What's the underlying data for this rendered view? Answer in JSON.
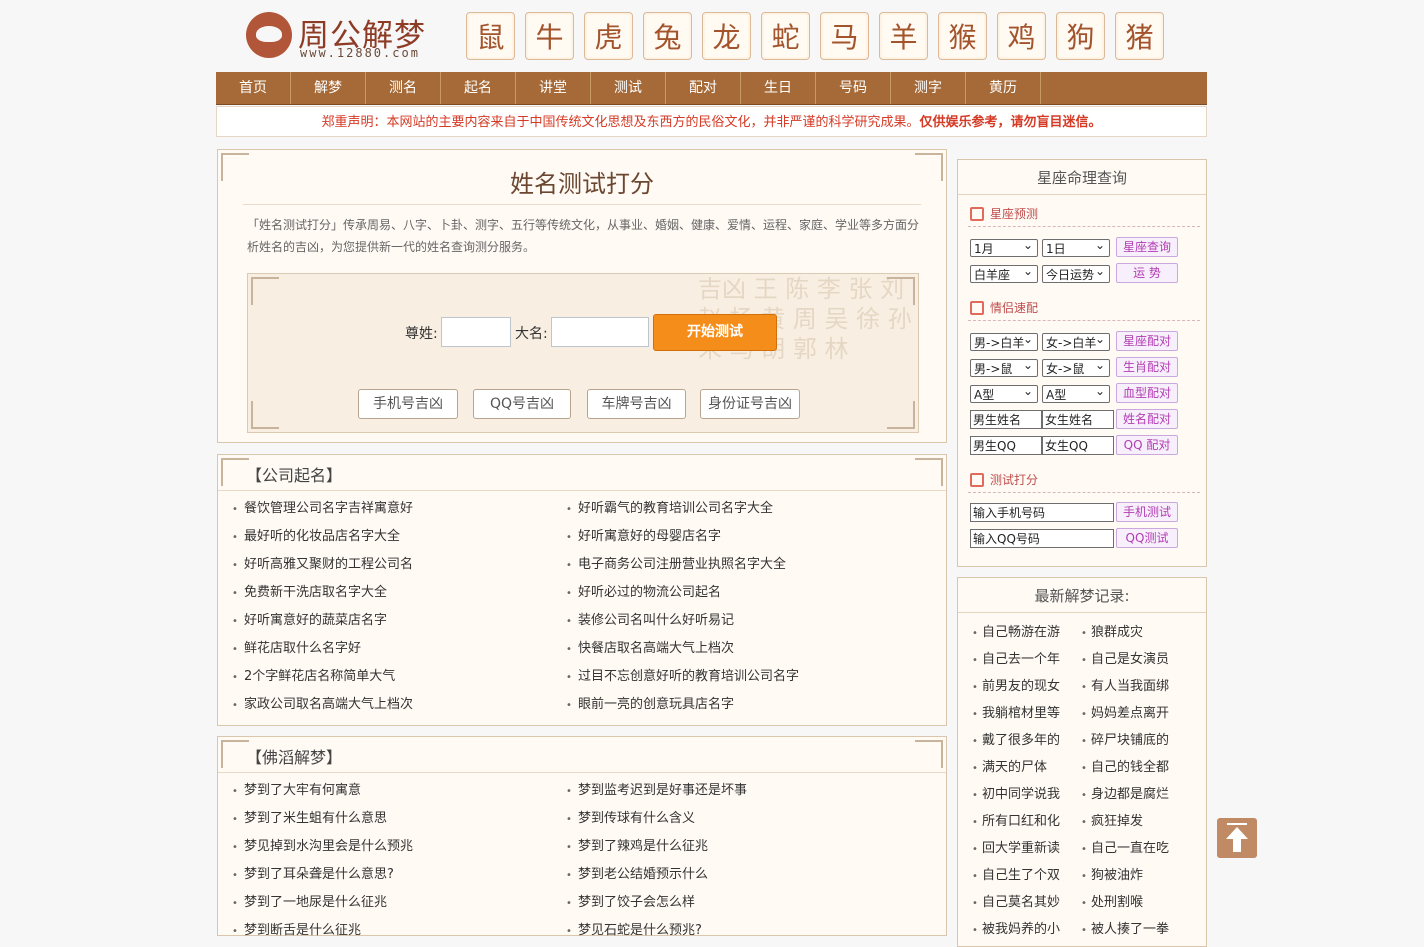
{
  "logo": {
    "name": "周公解梦",
    "url": "www.12880.com"
  },
  "zodiac": [
    "鼠",
    "牛",
    "虎",
    "兔",
    "龙",
    "蛇",
    "马",
    "羊",
    "猴",
    "鸡",
    "狗",
    "猪"
  ],
  "nav": [
    "首页",
    "解梦",
    "测名",
    "起名",
    "讲堂",
    "测试",
    "配对",
    "生日",
    "号码",
    "测字",
    "黄历"
  ],
  "notice": {
    "prefix": "郑重声明：本网站的主要内容来自于中国传统文化思想及东西方的民俗文化，并非严谨的科学研究成果。",
    "bold": "仅供娱乐参考，请勿盲目迷信。"
  },
  "name_test": {
    "title": "姓名测试打分",
    "desc": "「姓名测试打分」传承周易、八字、卜卦、测字、五行等传统文化，从事业、婚姻、健康、爱情、运程、家庭、学业等多方面分析姓名的吉凶，为您提供新一代的姓名查询测分服务。",
    "surname_label": "尊姓:",
    "name_label": "大名:",
    "start": "开始测试",
    "buttons": [
      "手机号吉凶",
      "QQ号吉凶",
      "车牌号吉凶",
      "身份证号吉凶"
    ],
    "bg_text": "吉凶 王 陈 李 张 刘 赵 杨 黄 周 吴 徐 孙 朱 马 胡 郭 林"
  },
  "company": {
    "title": "【公司起名】",
    "left": [
      "餐饮管理公司名字吉祥寓意好",
      "最好听的化妆品店名字大全",
      "好听高雅又聚财的工程公司名",
      "免费新干洗店取名字大全",
      "好听寓意好的蔬菜店名字",
      "鲜花店取什么名字好",
      "2个字鲜花店名称简单大气",
      "家政公司取名高端大气上档次"
    ],
    "right": [
      "好听霸气的教育培训公司名字大全",
      "好听寓意好的母婴店名字",
      "电子商务公司注册营业执照名字大全",
      "好听必过的物流公司起名",
      "装修公司名叫什么好听易记",
      "快餐店取名高端大气上档次",
      "过目不忘创意好听的教育培训公司名字",
      "眼前一亮的创意玩具店名字"
    ]
  },
  "dream": {
    "title": "【佛滔解梦】",
    "left": [
      "梦到了大牢有何寓意",
      "梦到了米生蛆有什么意思",
      "梦见掉到水沟里会是什么预兆",
      "梦到了耳朵聋是什么意思?",
      "梦到了一地尿是什么征兆",
      "梦到断舌是什么征兆"
    ],
    "right": [
      "梦到监考迟到是好事还是坏事",
      "梦到传球有什么含义",
      "梦到了辣鸡是什么征兆",
      "梦到老公结婚预示什么",
      "梦到了饺子会怎么样",
      "梦见石蛇是什么预兆?"
    ]
  },
  "star": {
    "title": "星座命理查询",
    "sec1": "星座预测",
    "month": "1月",
    "day": "1日",
    "btn_star": "星座查询",
    "sign": "白羊座",
    "period": "今日运势",
    "btn_fortune": "运 势",
    "sec2": "情侣速配",
    "male_sign": "男->白羊",
    "female_sign": "女->白羊",
    "btn_sign_match": "星座配对",
    "male_zodiac": "男->鼠",
    "female_zodiac": "女->鼠",
    "btn_zodiac_match": "生肖配对",
    "blood1": "A型",
    "blood2": "A型",
    "btn_blood": "血型配对",
    "male_name": "男生姓名",
    "female_name": "女生姓名",
    "btn_name": "姓名配对",
    "male_qq": "男生QQ",
    "female_qq": "女生QQ",
    "btn_qq": "QQ 配对",
    "sec3": "测试打分",
    "phone": "输入手机号码",
    "btn_phone": "手机测试",
    "qq": "输入QQ号码",
    "btn_qqtest": "QQ测试"
  },
  "records": {
    "title": "最新解梦记录:",
    "left": [
      "自己畅游在游",
      "自己去一个年",
      "前男友的现女",
      "我躺棺材里等",
      "戴了很多年的",
      "满天的尸体",
      "初中同学说我",
      "所有口红和化",
      "回大学重新读",
      "自己生了个双",
      "自己莫名其妙",
      "被我妈养的小"
    ],
    "right": [
      "狼群成灾",
      "自己是女演员",
      "有人当我面绑",
      "妈妈差点离开",
      "碎尸块铺底的",
      "自己的钱全都",
      "身边都是腐烂",
      "疯狂掉发",
      "自己一直在吃",
      "狗被油炸",
      "处刑割喉",
      "被人揍了一拳"
    ]
  }
}
